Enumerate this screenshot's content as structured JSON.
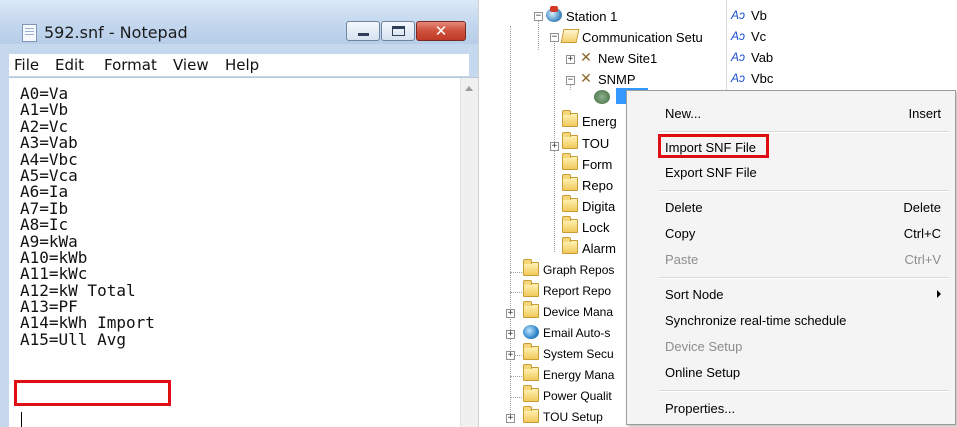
{
  "notepad": {
    "title": "592.snf - Notepad",
    "close_glyph": "✕",
    "menu": [
      "File",
      "Edit",
      "Format",
      "View",
      "Help"
    ],
    "lines": [
      "A0=Va",
      "A1=Vb",
      "A2=Vc",
      "A3=Vab",
      "A4=Vbc",
      "A5=Vca",
      "A6=Ia",
      "A7=Ib",
      "A8=Ic",
      "A9=kWa",
      "A10=kWb",
      "A11=kWc",
      "A12=kW Total",
      "A13=PF",
      "A14=kWh Import",
      "A15=Ull Avg"
    ],
    "highlighted_line": "A15=Ull Avg"
  },
  "tree": {
    "nodes": {
      "station": "Station 1",
      "comm_setup": "Communication Setu",
      "new_site": "New Site1",
      "snmp": "SNMP",
      "energy": "Energ",
      "tou": "TOU",
      "form": "Form",
      "report": "Repo",
      "digital": "Digita",
      "lock": "Lock",
      "alarm": "Alarm",
      "graph_repos": "Graph Repos",
      "report_repo": "Report Repo",
      "device_mana": "Device Mana",
      "email_auto": "Email Auto-s",
      "system_secu": "System Secu",
      "energy_mana": "Energy Mana",
      "power_quality": "Power Qualit",
      "tou_setup": "TOU Setup"
    },
    "items": [
      "Vb",
      "Vc",
      "Vab",
      "Vbc"
    ],
    "item_icon": "Aↄ"
  },
  "context_menu": {
    "new": {
      "label": "New...",
      "key": "Insert"
    },
    "import_snf": {
      "label": "Import SNF File"
    },
    "export_snf": {
      "label": "Export SNF File"
    },
    "delete": {
      "label": "Delete",
      "key": "Delete"
    },
    "copy": {
      "label": "Copy",
      "key": "Ctrl+C"
    },
    "paste": {
      "label": "Paste",
      "key": "Ctrl+V"
    },
    "sort_node": {
      "label": "Sort Node"
    },
    "sync": {
      "label": "Synchronize real-time schedule"
    },
    "device_setup": {
      "label": "Device Setup"
    },
    "online_setup": {
      "label": "Online Setup"
    },
    "properties": {
      "label": "Properties..."
    }
  },
  "colors": {
    "highlight_box": "#e00d12",
    "selection": "#3399ff"
  }
}
